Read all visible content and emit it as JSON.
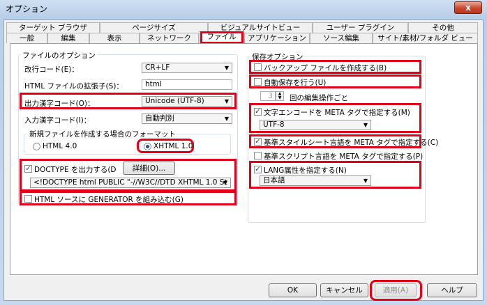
{
  "window": {
    "title": "オプション",
    "close_glyph": "x"
  },
  "tabs_top": [
    "ターゲット ブラウザ",
    "ページサイズ",
    "ビジュアルサイトビュー",
    "ユーザー プラグイン",
    "その他"
  ],
  "tabs_bottom": [
    "一般",
    "編集",
    "表示",
    "ネットワーク",
    "ファイル",
    "アプリケーション",
    "ソース編集",
    "サイト/素材/フォルダ ビュー"
  ],
  "file_options": {
    "group_label": "ファイルのオプション",
    "newline_label": "改行コード(E)：",
    "newline_value": "CR+LF",
    "ext_label": "HTML ファイルの拡張子(S)：",
    "ext_value": "html",
    "out_charset_label": "出力漢字コード(O)：",
    "out_charset_value": "Unicode (UTF-8)",
    "in_charset_label": "入力漢字コード(I)：",
    "in_charset_value": "自動判別",
    "format_label": "新規ファイルを作成する場合のフォーマット",
    "html4_label": "HTML 4.0",
    "xhtml_label": "XHTML 1.0",
    "doctype_label": "DOCTYPE を出力する(D",
    "detail_button": "詳細(O)...",
    "doctype_value": "<!DOCTYPE html PUBLIC \"-//W3C//DTD XHTML 1.0 St",
    "generator_label": "HTML ソースに GENERATOR を組み込む(G)"
  },
  "save_options": {
    "group_label": "保存オプション",
    "backup_label": "バックアップ ファイルを作成する(B)",
    "autosave_label": "自動保存を行う(U)",
    "edit_count": "3",
    "edit_count_label": "回の編集操作ごと",
    "meta_charset_label": "文字エンコードを META タグで指定する(M)",
    "meta_charset_value": "UTF-8",
    "style_lang_label": "基準スタイルシート言語を META タグで指定する(C)",
    "script_lang_label": "基準スクリプト言語を META タグで指定する(P)",
    "lang_attr_label": "LANG属性を指定する(N)",
    "lang_value": "日本語"
  },
  "buttons": {
    "ok": "OK",
    "cancel": "キャンセル",
    "apply": "適用(A)",
    "help": "ヘルプ"
  },
  "checks": {
    "doctype": "✓",
    "generator": "",
    "backup": "",
    "autosave": "",
    "meta_charset": "✓",
    "style_lang": "✓",
    "script_lang": "",
    "lang_attr": "✓"
  },
  "icons": {
    "dropdown": "▼",
    "spin_up": "▲",
    "spin_down": "▼"
  },
  "colors": {
    "highlight": "#e0001a",
    "title_bar": "#b9cfe8",
    "close_button": "#c9462c"
  }
}
